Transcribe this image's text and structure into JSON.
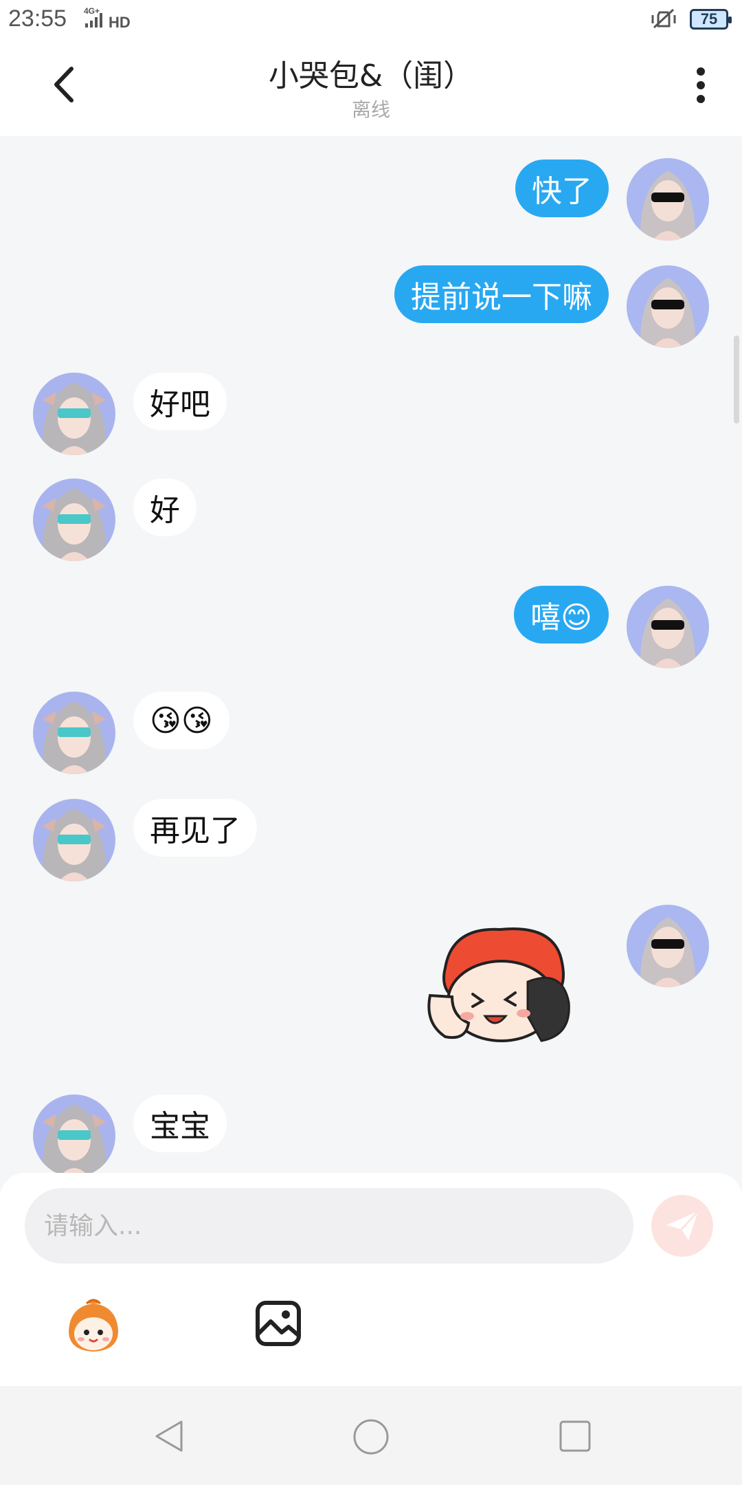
{
  "status_bar": {
    "time": "23:55",
    "network": "4G+",
    "hd": "HD",
    "battery": "75"
  },
  "header": {
    "title": "小哭包&（闺）",
    "subtitle": "离线"
  },
  "messages": [
    {
      "side": "self",
      "text": "快了"
    },
    {
      "side": "self",
      "text": "提前说一下嘛"
    },
    {
      "side": "other",
      "text": "好吧"
    },
    {
      "side": "other",
      "text": "好"
    },
    {
      "side": "self",
      "text": "嘻😊"
    },
    {
      "side": "other",
      "text": "😘😘"
    },
    {
      "side": "other",
      "text": "再见了"
    },
    {
      "side": "self",
      "type": "sticker"
    },
    {
      "side": "other",
      "text": "宝宝"
    }
  ],
  "input": {
    "placeholder": "请输入..."
  },
  "toolbar": {
    "emoji_icon": "cartoon-emoji-icon",
    "image_icon": "image-icon",
    "send_icon": "send-icon"
  },
  "colors": {
    "self_bubble": "#29a8f2",
    "other_bubble": "#ffffff",
    "send_button": "#fde3e0",
    "background": "#f4f6f8"
  }
}
